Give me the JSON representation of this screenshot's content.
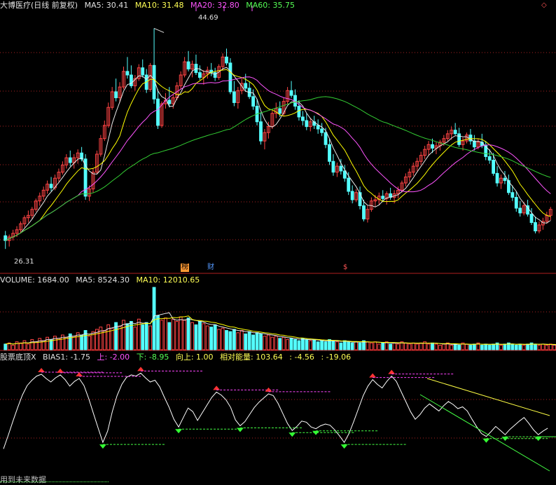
{
  "header_price": {
    "title": "大博医疗(日线 前复权)",
    "ma5": "MA5: 30.41",
    "ma10": "MA10: 31.48",
    "ma20": "MA20: 32.80",
    "ma60": "MA60: 35.75"
  },
  "header_volume": {
    "title": "VOLUME: 1684.00",
    "ma5": "MA5: 8524.30",
    "ma10": "MA10: 12010.65"
  },
  "header_indicator": {
    "title": "股票底顶X",
    "bias1": "BIAS1: -1.75",
    "up": "上: -2.00",
    "down": "下: -8.95",
    "upward": "向上: 1.00",
    "energy": "相对能量: 103.64",
    "v1": ": -4.56",
    "v2": ": -19.06"
  },
  "annotations": {
    "high_label": "44.69",
    "low_label": "26.31",
    "bang": "榜",
    "cai": "财",
    "dollar": "$"
  },
  "footer": "用到未来数据",
  "colors": {
    "up": "#ff4444",
    "down": "#54ffff",
    "ma5": "#e8e8e8",
    "ma10": "#ffff00",
    "ma20": "#ff55ff",
    "ma60": "#33cc33",
    "grid": "#aa2222",
    "separator": "#b02020"
  },
  "chart_data": [
    {
      "type": "candlestick",
      "title": "大博医疗(日线 前复权)",
      "ylim": [
        24.5,
        46.0
      ],
      "high_annotation": 44.69,
      "low_annotation": 26.31,
      "candles": [
        [
          27.4,
          27.8,
          26.3,
          27.0
        ],
        [
          27.0,
          27.5,
          26.5,
          27.3
        ],
        [
          27.3,
          27.9,
          27.0,
          27.6
        ],
        [
          27.6,
          28.2,
          27.3,
          27.9
        ],
        [
          27.9,
          28.6,
          27.6,
          28.4
        ],
        [
          28.4,
          29.1,
          28.1,
          28.9
        ],
        [
          28.9,
          29.5,
          28.5,
          29.1
        ],
        [
          29.1,
          29.8,
          28.8,
          29.6
        ],
        [
          29.6,
          30.5,
          29.4,
          30.3
        ],
        [
          30.3,
          31.0,
          29.9,
          30.7
        ],
        [
          30.7,
          31.5,
          30.4,
          31.2
        ],
        [
          31.2,
          32.0,
          30.9,
          31.7
        ],
        [
          31.7,
          32.3,
          31.1,
          31.4
        ],
        [
          31.4,
          32.5,
          31.2,
          32.2
        ],
        [
          32.2,
          33.0,
          31.9,
          32.7
        ],
        [
          32.7,
          33.6,
          32.5,
          33.3
        ],
        [
          33.3,
          34.2,
          33.0,
          33.9
        ],
        [
          33.9,
          34.5,
          33.2,
          33.5
        ],
        [
          33.5,
          34.2,
          33.0,
          33.9
        ],
        [
          33.9,
          34.6,
          33.4,
          34.3
        ],
        [
          34.3,
          34.8,
          33.6,
          33.8
        ],
        [
          33.8,
          34.2,
          30.4,
          30.7
        ],
        [
          30.7,
          31.6,
          30.3,
          31.3
        ],
        [
          31.3,
          33.0,
          31.0,
          32.7
        ],
        [
          32.7,
          34.5,
          32.5,
          34.2
        ],
        [
          34.2,
          35.8,
          34.0,
          35.5
        ],
        [
          35.5,
          37.0,
          35.3,
          36.6
        ],
        [
          36.6,
          38.5,
          36.4,
          38.1
        ],
        [
          38.1,
          39.8,
          37.9,
          39.4
        ],
        [
          39.4,
          40.5,
          38.6,
          38.9
        ],
        [
          38.9,
          40.2,
          38.5,
          39.8
        ],
        [
          39.8,
          41.5,
          39.6,
          41.1
        ],
        [
          41.1,
          42.3,
          40.5,
          40.8
        ],
        [
          40.8,
          41.6,
          39.7,
          39.9
        ],
        [
          39.9,
          40.8,
          39.5,
          40.5
        ],
        [
          40.5,
          41.7,
          40.3,
          41.4
        ],
        [
          41.4,
          42.1,
          40.6,
          40.8
        ],
        [
          40.8,
          41.3,
          39.3,
          39.6
        ],
        [
          39.6,
          41.8,
          39.4,
          41.6
        ],
        [
          41.6,
          44.69,
          38.4,
          38.8
        ],
        [
          38.8,
          39.6,
          36.3,
          36.6
        ],
        [
          36.6,
          38.6,
          36.4,
          38.4
        ],
        [
          38.4,
          39.3,
          38.0,
          38.7
        ],
        [
          38.7,
          39.8,
          38.1,
          38.4
        ],
        [
          38.4,
          39.2,
          38.0,
          38.9
        ],
        [
          38.9,
          40.2,
          38.7,
          39.9
        ],
        [
          39.9,
          41.1,
          39.6,
          40.8
        ],
        [
          40.8,
          42.3,
          40.6,
          41.9
        ],
        [
          41.9,
          42.8,
          41.1,
          41.3
        ],
        [
          41.3,
          42.0,
          40.6,
          41.7
        ],
        [
          41.7,
          42.5,
          40.8,
          41.0
        ],
        [
          41.0,
          41.6,
          40.4,
          40.6
        ],
        [
          40.6,
          41.2,
          40.0,
          40.9
        ],
        [
          40.9,
          41.5,
          40.5,
          41.2
        ],
        [
          41.2,
          41.8,
          40.7,
          41.0
        ],
        [
          41.0,
          41.4,
          40.3,
          40.6
        ],
        [
          40.6,
          41.7,
          40.4,
          41.5
        ],
        [
          41.5,
          42.6,
          41.2,
          42.3
        ],
        [
          42.3,
          43.0,
          41.6,
          41.8
        ],
        [
          41.8,
          42.2,
          39.2,
          39.4
        ],
        [
          39.4,
          40.3,
          38.2,
          38.5
        ],
        [
          38.5,
          39.8,
          38.0,
          39.5
        ],
        [
          39.5,
          40.5,
          39.2,
          40.1
        ],
        [
          40.1,
          40.9,
          39.4,
          39.7
        ],
        [
          39.7,
          40.2,
          38.8,
          39.0
        ],
        [
          39.0,
          39.6,
          37.9,
          38.2
        ],
        [
          38.2,
          38.8,
          36.6,
          36.9
        ],
        [
          36.9,
          37.7,
          35.0,
          35.3
        ],
        [
          35.3,
          36.3,
          34.6,
          36.0
        ],
        [
          36.0,
          36.9,
          35.5,
          36.5
        ],
        [
          36.5,
          37.8,
          36.3,
          37.6
        ],
        [
          37.6,
          38.5,
          37.2,
          38.0
        ],
        [
          38.0,
          38.6,
          37.3,
          37.6
        ],
        [
          37.6,
          38.9,
          37.4,
          38.6
        ],
        [
          38.6,
          39.8,
          38.4,
          39.5
        ],
        [
          39.5,
          40.3,
          38.9,
          39.1
        ],
        [
          39.1,
          39.6,
          37.9,
          38.2
        ],
        [
          38.2,
          38.7,
          37.0,
          37.3
        ],
        [
          37.3,
          37.8,
          36.6,
          37.0
        ],
        [
          37.0,
          37.6,
          36.2,
          36.5
        ],
        [
          36.5,
          37.2,
          36.1,
          36.9
        ],
        [
          36.9,
          37.4,
          36.3,
          36.6
        ],
        [
          36.6,
          37.1,
          35.9,
          36.3
        ],
        [
          36.3,
          36.8,
          35.7,
          36.0
        ],
        [
          36.0,
          36.4,
          34.7,
          35.0
        ],
        [
          35.0,
          35.5,
          33.3,
          33.6
        ],
        [
          33.6,
          34.2,
          32.4,
          32.7
        ],
        [
          32.7,
          33.5,
          32.3,
          33.2
        ],
        [
          33.2,
          33.8,
          32.5,
          32.8
        ],
        [
          32.8,
          33.3,
          31.9,
          32.2
        ],
        [
          32.2,
          32.7,
          30.8,
          31.1
        ],
        [
          31.1,
          31.6,
          30.1,
          30.4
        ],
        [
          30.4,
          31.3,
          30.2,
          31.0
        ],
        [
          31.0,
          31.5,
          29.6,
          29.9
        ],
        [
          29.9,
          30.4,
          28.6,
          28.8
        ],
        [
          28.8,
          29.9,
          28.5,
          29.6
        ],
        [
          29.6,
          30.6,
          29.4,
          30.3
        ],
        [
          30.3,
          30.8,
          29.8,
          30.4
        ],
        [
          30.4,
          31.0,
          30.0,
          30.7
        ],
        [
          30.7,
          31.2,
          30.2,
          30.5
        ],
        [
          30.5,
          31.1,
          30.0,
          30.9
        ],
        [
          30.9,
          31.4,
          30.4,
          30.6
        ],
        [
          30.6,
          31.2,
          30.1,
          30.9
        ],
        [
          30.9,
          31.5,
          30.5,
          31.2
        ],
        [
          31.2,
          32.0,
          31.0,
          31.8
        ],
        [
          31.8,
          32.6,
          31.5,
          32.3
        ],
        [
          32.3,
          33.0,
          31.9,
          32.7
        ],
        [
          32.7,
          33.5,
          32.4,
          33.2
        ],
        [
          33.2,
          33.9,
          32.8,
          33.6
        ],
        [
          33.6,
          34.4,
          33.3,
          34.1
        ],
        [
          34.1,
          34.9,
          33.8,
          34.6
        ],
        [
          34.6,
          35.3,
          34.1,
          35.0
        ],
        [
          35.0,
          35.5,
          34.3,
          34.7
        ],
        [
          34.7,
          35.2,
          34.2,
          34.9
        ],
        [
          34.9,
          35.4,
          34.5,
          35.2
        ],
        [
          35.2,
          35.8,
          34.9,
          35.5
        ],
        [
          35.5,
          36.2,
          35.3,
          35.9
        ],
        [
          35.9,
          36.5,
          35.4,
          36.2
        ],
        [
          36.2,
          36.8,
          35.8,
          35.9
        ],
        [
          35.9,
          36.4,
          34.8,
          35.0
        ],
        [
          35.0,
          35.6,
          34.5,
          35.3
        ],
        [
          35.3,
          36.0,
          35.1,
          35.8
        ],
        [
          35.8,
          36.3,
          35.0,
          35.3
        ],
        [
          35.3,
          35.8,
          34.5,
          34.8
        ],
        [
          34.8,
          35.5,
          34.6,
          35.2
        ],
        [
          35.2,
          35.9,
          34.7,
          34.9
        ],
        [
          34.9,
          35.3,
          33.7,
          34.0
        ],
        [
          34.0,
          34.6,
          33.4,
          33.7
        ],
        [
          33.7,
          34.3,
          32.4,
          32.6
        ],
        [
          32.6,
          33.2,
          31.5,
          31.8
        ],
        [
          31.8,
          32.5,
          31.3,
          32.2
        ],
        [
          32.2,
          32.8,
          31.7,
          32.0
        ],
        [
          32.0,
          32.5,
          30.8,
          31.0
        ],
        [
          31.0,
          31.6,
          30.3,
          30.6
        ],
        [
          30.6,
          31.1,
          29.4,
          29.7
        ],
        [
          29.7,
          30.3,
          29.0,
          29.3
        ],
        [
          29.3,
          30.2,
          29.1,
          29.9
        ],
        [
          29.9,
          30.4,
          29.0,
          29.2
        ],
        [
          29.2,
          29.7,
          28.3,
          28.5
        ],
        [
          28.5,
          29.0,
          27.6,
          27.8
        ],
        [
          27.8,
          28.6,
          27.6,
          28.3
        ],
        [
          28.3,
          28.9,
          27.9,
          28.6
        ],
        [
          28.6,
          29.4,
          28.4,
          29.1
        ],
        [
          29.1,
          29.8,
          28.7,
          29.6
        ]
      ]
    },
    {
      "type": "bar",
      "title": "VOLUME: 1684.00",
      "series": [
        {
          "name": "VOLUME",
          "values": [
            5,
            6,
            4,
            7,
            6,
            8,
            5,
            9,
            7,
            10,
            8,
            11,
            9,
            12,
            10,
            13,
            11,
            14,
            12,
            15,
            13,
            17,
            12,
            16,
            18,
            20,
            17,
            22,
            19,
            24,
            21,
            26,
            23,
            25,
            20,
            27,
            22,
            24,
            21,
            55,
            30,
            26,
            28,
            24,
            27,
            25,
            29,
            26,
            28,
            24,
            22,
            25,
            23,
            21,
            20,
            22,
            18,
            19,
            17,
            16,
            18,
            15,
            17,
            14,
            16,
            13,
            15,
            14,
            12,
            13,
            11,
            12,
            10,
            11,
            9,
            10,
            9,
            8,
            10,
            9,
            8,
            9,
            7,
            8,
            7,
            9,
            8,
            7,
            6,
            8,
            7,
            6,
            7,
            6,
            8,
            7,
            6,
            7,
            5,
            6,
            7,
            5,
            6,
            5,
            7,
            6,
            5,
            6,
            5,
            6,
            7,
            5,
            6,
            5,
            4,
            5,
            6,
            4,
            5,
            4,
            6,
            5,
            4,
            5,
            6,
            4,
            5,
            4,
            5,
            6,
            4,
            5,
            6,
            5,
            4,
            5,
            4,
            5,
            6,
            5,
            4,
            5,
            4,
            5,
            4,
            3
          ]
        }
      ]
    },
    {
      "type": "line",
      "title": "股票底顶X",
      "series": [
        {
          "name": "BIAS1",
          "values": [
            -5.5,
            -3.2,
            -0.8,
            1.5,
            3.6,
            5.2,
            6.1,
            6.8,
            7.1,
            6.4,
            5.8,
            6.5,
            7.0,
            6.2,
            5.1,
            5.9,
            6.4,
            5.2,
            3.0,
            0.5,
            -2.0,
            -4.4,
            -2.5,
            0.8,
            3.5,
            5.4,
            6.6,
            7.0,
            6.8,
            7.3,
            6.5,
            5.8,
            6.1,
            5.0,
            3.2,
            1.5,
            -0.5,
            -1.8,
            -0.2,
            1.4,
            0.8,
            -0.7,
            0.6,
            1.9,
            3.2,
            4.1,
            3.6,
            2.8,
            1.5,
            -0.6,
            -1.6,
            -0.9,
            0.3,
            1.5,
            2.4,
            3.1,
            3.8,
            3.5,
            2.2,
            0.5,
            -1.2,
            -2.4,
            -1.7,
            -0.8,
            -1.0,
            -1.8,
            -2.1,
            -1.6,
            -1.3,
            -1.5,
            -2.3,
            -3.3,
            -4.4,
            -2.9,
            -0.9,
            1.3,
            3.5,
            5.1,
            6.2,
            5.4,
            4.8,
            5.9,
            6.8,
            5.9,
            4.2,
            2.5,
            0.8,
            -0.5,
            0.3,
            1.4,
            2.1,
            1.5,
            0.9,
            1.8,
            2.5,
            2.0,
            1.3,
            1.6,
            0.9,
            -0.5,
            -1.8,
            -2.9,
            -3.4,
            -2.6,
            -1.7,
            -2.4,
            -3.1,
            -2.2,
            -1.5,
            -0.8,
            -0.2,
            -1.2,
            -2.3,
            -3.1,
            -2.5,
            -2.0
          ]
        }
      ]
    }
  ]
}
